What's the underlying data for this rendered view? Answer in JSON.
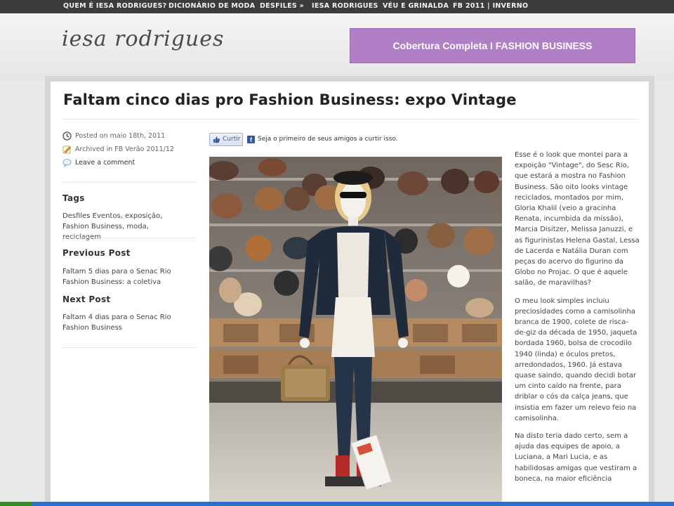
{
  "nav": {
    "items": [
      "QUEM É IESA RODRIGUES?",
      "DICIONÁRIO DE MODA",
      "DESFILES »",
      "IESA RODRIGUES",
      "VÉU E GRINALDA",
      "FB 2011 | INVERNO"
    ]
  },
  "header": {
    "logo": "iesa rodrigues",
    "banner": "Cobertura Completa I FASHION BUSINESS"
  },
  "post": {
    "title": "Faltam cinco dias pro Fashion Business: expo Vintage",
    "posted": "Posted on maio 18th, 2011",
    "archived_prefix": "Archived in ",
    "archived_link": "FB Verão 2011/12",
    "comment": "Leave a comment"
  },
  "sidebar": {
    "tags_heading": "Tags",
    "tags_text": "Desfiles Eventos, exposição, Fashion Business, moda, reciclagem",
    "prev_heading": "Previous Post",
    "prev_link": "Faltam 5 dias para o Senac Rio Fashion Business: a coletiva",
    "next_heading": "Next Post",
    "next_link": "Faltam 4 dias para o Senac Rio Fashion Business"
  },
  "facebook": {
    "like_label": "Curtir",
    "fb_letter": "f",
    "text": "Seja o primeiro de seus amigos a curtir isso."
  },
  "article": {
    "paragraphs": [
      "Esse é o look que montei para a expoição \"Vintage\", do Sesc Rio, que estará a mostra no Fashion Business. São oito looks vintage reciclados, montados por mim, Gloria Khalil (veio a gracinha Renata, incumbida da missão), Marcia Disitzer, Melissa Januzzi, e as figurinistas Helena Gastal, Lessa de Lacerda e Natália Duran com peças do acervo do figurino da Globo no Projac. O que é aquele salão, de maravilhas?",
      "O meu look simples incluiu preciosidades como a camisolinha branca de 1900, colete de risca-de-giz da década de 1950, jaqueta bordada 1960, bolsa de crocodilo 1940 (linda) e óculos pretos, arredondados, 1960. Já estava quase saindo, quando decidi botar um cinto caído na frente, para driblar o cós da calça jeans, que insistia em fazer um relevo feio na camisolinha.",
      "Na disto teria dado certo, sem a ajuda das equipes de apoio, a Luciana, a Mari Lucia, e as habilidosas amigas que vestiram a boneca, na maior eficiência"
    ]
  },
  "colors": {
    "nav_bg": "#3c3c3c",
    "banner_bg": "#b07fc6",
    "fb_blue": "#3b5998"
  },
  "icons": [
    "clock-icon",
    "pencil-icon",
    "comment-bubble-icon",
    "thumbs-up-icon",
    "facebook-icon"
  ]
}
